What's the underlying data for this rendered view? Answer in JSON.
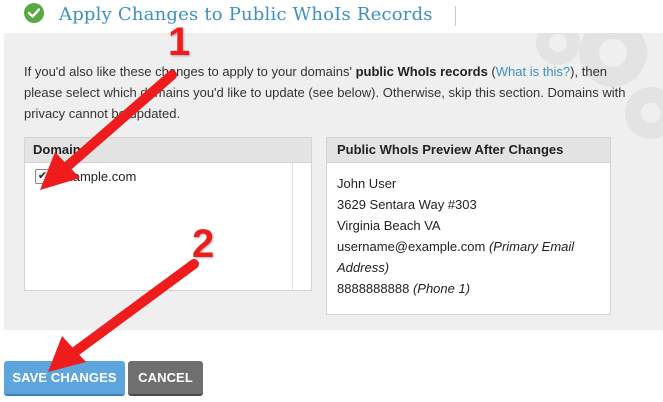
{
  "header": {
    "title": "Apply Changes to Public WhoIs Records"
  },
  "intro": {
    "part1": "If you'd also like these changes to apply to your domains' ",
    "bold": "public WhoIs records",
    "part2": " (",
    "link": "What is this?",
    "part3": "), then please select which domains you'd like to update (see below). Otherwise, skip this section. Domains with privacy cannot be updated."
  },
  "domains": {
    "header": "Domain",
    "items": [
      {
        "name": "example.com",
        "checked": true
      }
    ]
  },
  "preview": {
    "header": "Public WhoIs Preview After Changes",
    "name": "John User",
    "street": "3629 Sentara Way #303",
    "city": "Virginia Beach VA",
    "email": "username@example.com",
    "email_note": "(Primary Email Address)",
    "phone": "8888888888",
    "phone_note": "(Phone 1)"
  },
  "buttons": {
    "save": "SAVE CHANGES",
    "cancel": "CANCEL"
  },
  "annotations": [
    {
      "label": "1"
    },
    {
      "label": "2"
    }
  ],
  "colors": {
    "accent": "#3d8fc4",
    "check": "#5aa845",
    "save": "#5da6dd",
    "cancel": "#6f6f6f",
    "arrow": "#ee1c1c"
  }
}
